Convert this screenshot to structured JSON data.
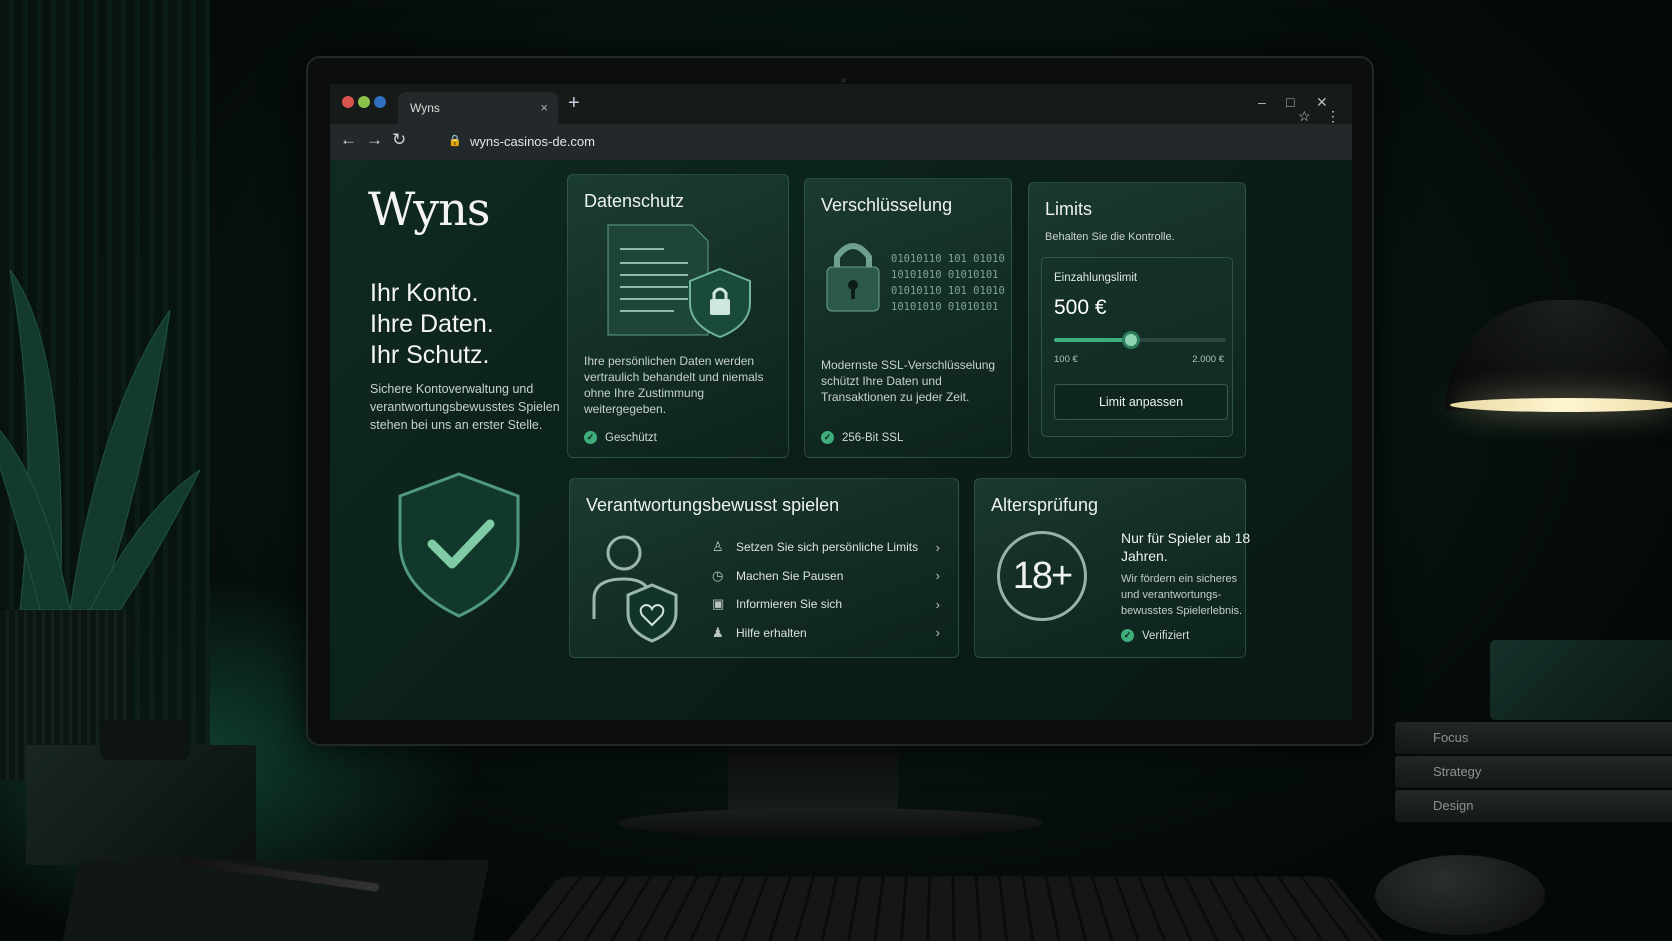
{
  "browser": {
    "tab_title": "Wyns",
    "tab_close": "×",
    "new_tab": "+",
    "url": "wyns-casinos-de.com",
    "back": "←",
    "forward": "→",
    "reload": "↻",
    "lock": "🔒",
    "bookmark": "☆",
    "menu": "⋮",
    "minimize": "–",
    "maximize": "□",
    "close": "✕"
  },
  "hero": {
    "logo": "Wyns",
    "headline": [
      "Ihr Konto.",
      "Ihre Daten.",
      "Ihr Schutz."
    ],
    "intro": "Sichere Kontoverwaltung und verantwortungsbewusstes Spielen stehen bei uns an erster Stelle."
  },
  "datenschutz": {
    "title": "Datenschutz",
    "text": "Ihre persönlichen Daten werden vertraulich behandelt und niemals ohne Ihre Zustimmung weitergegeben.",
    "badge": "Geschützt"
  },
  "verschluesselung": {
    "title": "Verschlüsselung",
    "binary": "01010110 101 01010\n10101010 01010101\n01010110 101 01010\n10101010 01010101",
    "text": "Modernste SSL-Verschlüsselung schützt Ihre Daten und Transaktionen zu jeder Zeit.",
    "badge": "256-Bit SSL"
  },
  "limits": {
    "title": "Limits",
    "subtitle": "Behalten Sie die Kontrolle.",
    "deposit_label": "Einzahlungslimit",
    "deposit_value": "500 €",
    "range_min": "100 €",
    "range_max": "2.000 €",
    "slider_fraction": 0.45,
    "button": "Limit anpassen"
  },
  "responsible": {
    "title": "Verantwortungsbewusst spielen",
    "items": [
      {
        "icon": "person-limit-icon",
        "glyph": "♙",
        "label": "Setzen Sie sich persönliche Limits"
      },
      {
        "icon": "clock-icon",
        "glyph": "◷",
        "label": "Machen Sie Pausen"
      },
      {
        "icon": "info-icon",
        "glyph": "▣",
        "label": "Informieren Sie sich"
      },
      {
        "icon": "user-icon",
        "glyph": "♟",
        "label": "Hilfe erhalten"
      }
    ],
    "chevron": "›"
  },
  "age": {
    "title": "Altersprüfung",
    "badge_text": "18+",
    "heading": "Nur für Spieler ab 18 Jahren.",
    "text": "Wir fördern ein sicheres und verantwortungs-bewusstes Spielerlebnis.",
    "badge": "Verifiziert"
  },
  "books": [
    "Focus",
    "Strategy",
    "Design"
  ],
  "colors": {
    "accent": "#3fae7b",
    "background": "#0c1c17"
  }
}
